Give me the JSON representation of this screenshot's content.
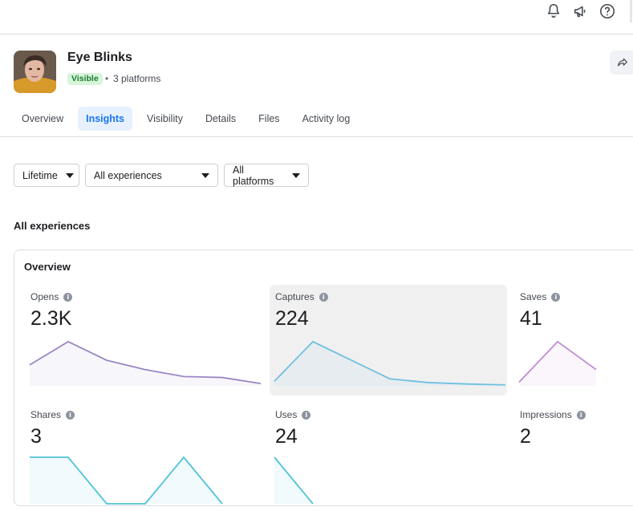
{
  "top_icons": [
    "bell-icon",
    "megaphone-icon",
    "help-icon"
  ],
  "effect": {
    "title": "Eye Blinks",
    "status": "Visible",
    "separator": "•",
    "platforms": "3 platforms"
  },
  "tabs": [
    {
      "label": "Overview",
      "active": false
    },
    {
      "label": "Insights",
      "active": true
    },
    {
      "label": "Visibility",
      "active": false
    },
    {
      "label": "Details",
      "active": false
    },
    {
      "label": "Files",
      "active": false
    },
    {
      "label": "Activity log",
      "active": false
    }
  ],
  "filters": {
    "time": "Lifetime",
    "experience": "All experiences",
    "platform": "All platforms"
  },
  "section_title": "All experiences",
  "overview": {
    "title": "Overview",
    "info_glyph": "i",
    "metrics": [
      {
        "label": "Opens",
        "value": "2.3K",
        "color": "#9b86c4",
        "trend": [
          0.45,
          0.95,
          0.55,
          0.35,
          0.2,
          0.18,
          0.05
        ]
      },
      {
        "label": "Captures",
        "value": "224",
        "color": "#6fbfdf",
        "trend": [
          0.1,
          0.95,
          0.55,
          0.15,
          0.07,
          0.04,
          0.02
        ]
      },
      {
        "label": "Saves",
        "value": "41",
        "color": "#c08bd6",
        "trend": [
          0.08,
          0.95,
          0.35
        ]
      },
      {
        "label": "Shares",
        "value": "3",
        "color": "#4fc4d8",
        "trend": [
          1,
          1,
          0,
          0,
          1,
          0
        ]
      },
      {
        "label": "Uses",
        "value": "24",
        "color": "#4fc4d8",
        "trend": [
          1,
          0
        ]
      },
      {
        "label": "Impressions",
        "value": "2",
        "color": "#9b86c4",
        "trend": []
      }
    ]
  }
}
